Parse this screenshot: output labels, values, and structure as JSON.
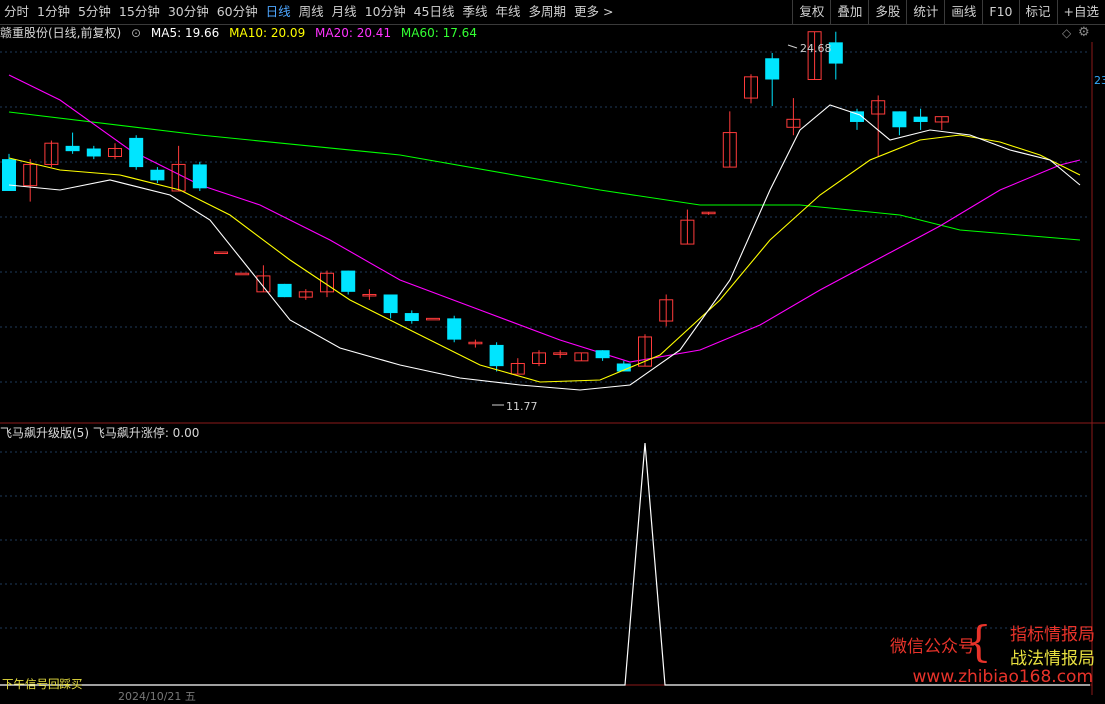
{
  "toolbar": {
    "periods": [
      "分时",
      "1分钟",
      "5分钟",
      "15分钟",
      "30分钟",
      "60分钟",
      "日线",
      "周线",
      "月线",
      "10分钟",
      "45日线",
      "季线",
      "年线",
      "多周期",
      "更多 >"
    ],
    "active_index": 6,
    "right_items": [
      "复权",
      "叠加",
      "多股",
      "统计",
      "画线",
      "F10",
      "标记",
      "+自选"
    ]
  },
  "info": {
    "stock": "赣重股份(日线,前复权)",
    "ma5": "MA5: 19.66",
    "ma10": "MA10: 20.09",
    "ma20": "MA20: 20.41",
    "ma60": "MA60: 17.64",
    "price_edge": "23"
  },
  "indicator": {
    "name": "飞马飙升级版(5)",
    "value": "飞马飙升涨停: 0.00"
  },
  "annotations": {
    "high": "24.68",
    "low": "11.77"
  },
  "bottom": {
    "signal_label": "下午信号回踩买",
    "date": "2024/10/21 五"
  },
  "watermark": {
    "left": "微信公众号",
    "line1": "指标情报局",
    "line2": "战法情报局",
    "url": "www.zhibiao168.com"
  },
  "colors": {
    "up": "#ff3b3b",
    "down": "#00e5ff",
    "ma5": "#ffffff",
    "ma10": "#ffff00",
    "ma20": "#ff00ff",
    "ma60": "#00ff00",
    "active": "#4da6ff"
  },
  "chart_data": {
    "type": "candlestick",
    "y_high": 24.68,
    "y_low": 11.77,
    "candles": [
      [
        20.6,
        19.4,
        20.8,
        19.4
      ],
      [
        19.6,
        20.4,
        20.6,
        19.0
      ],
      [
        20.4,
        21.2,
        21.3,
        20.3
      ],
      [
        21.1,
        20.9,
        21.6,
        20.8
      ],
      [
        21.0,
        20.7,
        21.1,
        20.6
      ],
      [
        20.7,
        21.0,
        21.2,
        20.6
      ],
      [
        21.4,
        20.3,
        21.5,
        20.2
      ],
      [
        20.2,
        19.8,
        20.3,
        19.7
      ],
      [
        19.4,
        20.4,
        21.1,
        19.4
      ],
      [
        20.4,
        19.5,
        20.5,
        19.4
      ],
      [
        17.1,
        17.1,
        17.1,
        17.1
      ],
      [
        16.3,
        16.3,
        16.3,
        16.3
      ],
      [
        15.6,
        16.2,
        16.6,
        15.6
      ],
      [
        15.9,
        15.4,
        15.9,
        15.4
      ],
      [
        15.4,
        15.6,
        15.7,
        15.3
      ],
      [
        15.6,
        16.3,
        16.4,
        15.4
      ],
      [
        16.4,
        15.6,
        16.4,
        15.5
      ],
      [
        15.5,
        15.5,
        15.7,
        15.3
      ],
      [
        15.5,
        14.8,
        15.5,
        14.6
      ],
      [
        14.8,
        14.5,
        14.9,
        14.4
      ],
      [
        14.6,
        14.6,
        14.6,
        14.6
      ],
      [
        14.6,
        13.8,
        14.7,
        13.7
      ],
      [
        13.7,
        13.7,
        13.8,
        13.5
      ],
      [
        13.6,
        12.8,
        13.7,
        12.6
      ],
      [
        12.5,
        12.9,
        13.1,
        12.7
      ],
      [
        12.9,
        13.3,
        13.4,
        12.8
      ],
      [
        13.3,
        13.3,
        13.4,
        13.1
      ],
      [
        13.0,
        13.3,
        13.3,
        13.0
      ],
      [
        13.4,
        13.1,
        13.4,
        13.0
      ],
      [
        12.9,
        12.6,
        13.0,
        12.6
      ],
      [
        12.8,
        13.9,
        14.0,
        12.8
      ],
      [
        14.5,
        15.3,
        15.5,
        14.3
      ],
      [
        17.4,
        18.3,
        18.7,
        17.4
      ],
      [
        18.6,
        18.6,
        18.6,
        18.5
      ],
      [
        20.3,
        21.6,
        22.4,
        20.3
      ],
      [
        22.9,
        23.7,
        23.8,
        22.7
      ],
      [
        24.4,
        23.6,
        24.6,
        22.6
      ],
      [
        21.8,
        22.1,
        22.9,
        21.5
      ],
      [
        23.6,
        25.4,
        24.68,
        23.6
      ],
      [
        25.0,
        24.2,
        25.4,
        23.6
      ],
      [
        22.4,
        22.0,
        22.5,
        21.7
      ],
      [
        22.3,
        22.8,
        23.0,
        20.7
      ],
      [
        22.4,
        21.8,
        22.4,
        21.5
      ],
      [
        22.2,
        22.0,
        22.5,
        21.7
      ],
      [
        22.0,
        22.2,
        22.1,
        21.7
      ]
    ],
    "ma": [],
    "sub_signal": {
      "peak_index": 30,
      "peak_value": 1
    }
  }
}
